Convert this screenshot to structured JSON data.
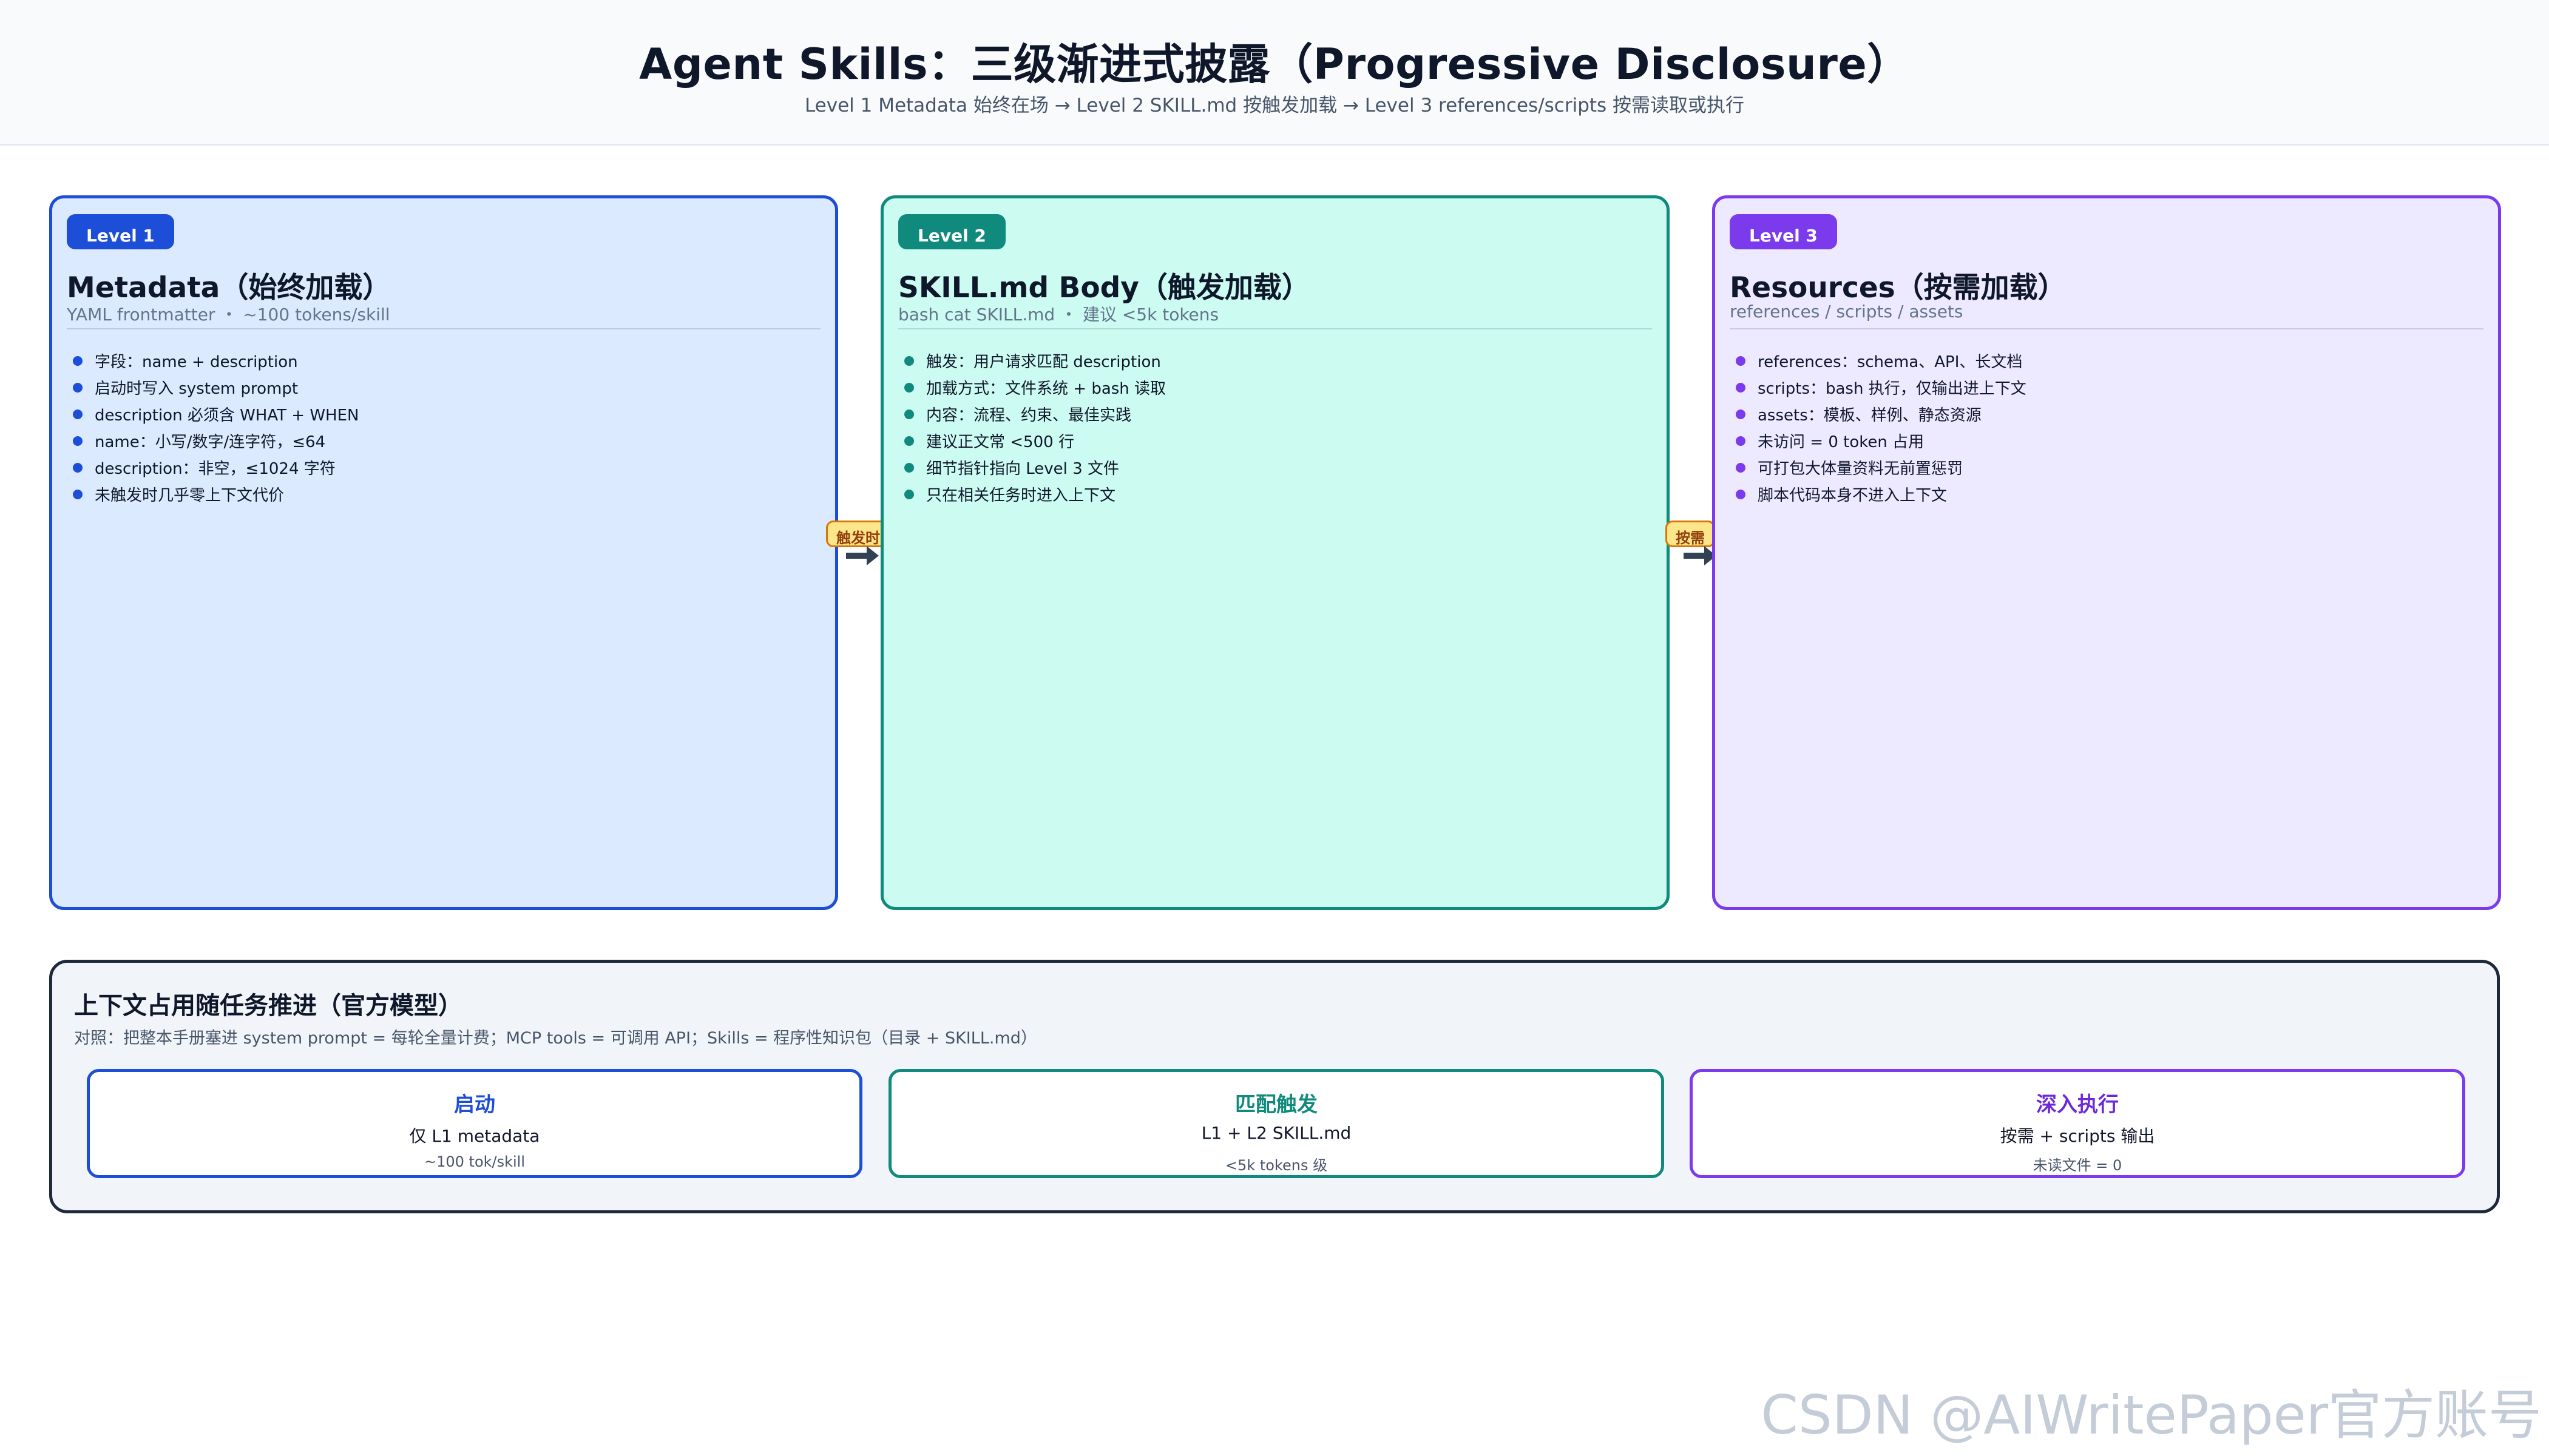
{
  "header": {
    "title": "Agent Skills：三级渐进式披露（Progressive Disclosure）",
    "subtitle": "Level 1 Metadata 始终在场 → Level 2 SKILL.md 按触发加载 → Level 3 references/scripts 按需读取或执行"
  },
  "levels": [
    {
      "badge": "Level 1",
      "title": "Metadata（始终加载）",
      "subtitle": "YAML frontmatter ・ ~100 tokens/skill",
      "bullets": [
        "字段：name + description",
        "启动时写入 system prompt",
        "description 必须含 WHAT + WHEN",
        "name：小写/数字/连字符，≤64",
        "description：非空，≤1024 字符",
        "未触发时几乎零上下文代价"
      ]
    },
    {
      "badge": "Level 2",
      "title": "SKILL.md Body（触发加载）",
      "subtitle": "bash cat SKILL.md ・ 建议 <5k tokens",
      "bullets": [
        "触发：用户请求匹配 description",
        "加载方式：文件系统 + bash 读取",
        "内容：流程、约束、最佳实践",
        "建议正文常 <500 行",
        "细节指针指向 Level 3 文件",
        "只在相关任务时进入上下文"
      ]
    },
    {
      "badge": "Level 3",
      "title": "Resources（按需加载）",
      "subtitle": "references / scripts / assets",
      "bullets": [
        "references：schema、API、长文档",
        "scripts：bash 执行，仅输出进上下文",
        "assets：模板、样例、静态资源",
        "未访问 = 0 token 占用",
        "可打包大体量资料无前置惩罚",
        "脚本代码本身不进入上下文"
      ]
    }
  ],
  "connectors": [
    {
      "label": "触发时",
      "icon": "arrow-right-icon"
    },
    {
      "label": "按需",
      "icon": "arrow-right-icon"
    }
  ],
  "panel": {
    "title": "上下文占用随任务推进（官方模型）",
    "subtitle": "对照：把整本手册塞进 system prompt = 每轮全量计费；MCP tools = 可调用 API；Skills = 程序性知识包（目录 + SKILL.md）",
    "stages": [
      {
        "title": "启动",
        "line1": "仅 L1 metadata",
        "line2": "~100 tok/skill"
      },
      {
        "title": "匹配触发",
        "line1": "L1 + L2 SKILL.md",
        "line2": "<5k tokens 级"
      },
      {
        "title": "深入执行",
        "line1": "按需 + scripts 输出",
        "line2": "未读文件 = 0"
      }
    ]
  },
  "watermark": "CSDN @AIWritePaper官方账号",
  "colors": {
    "level1": "#1d4ed8",
    "level2": "#0f8a7d",
    "level3": "#7c3aed",
    "connector": "#d97706",
    "arrow": "#334155"
  }
}
